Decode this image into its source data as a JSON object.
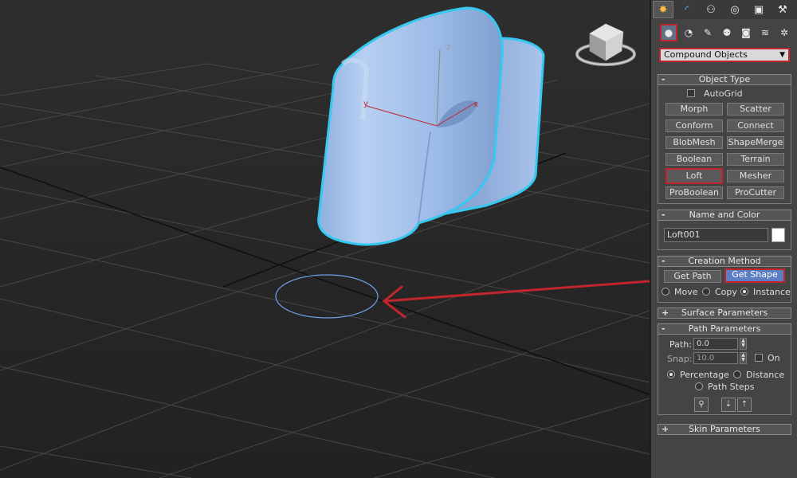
{
  "command_panel": {
    "tabs": [
      {
        "icon": "create-tab-icon",
        "glyph": "✸"
      },
      {
        "icon": "modify-tab-icon",
        "glyph": "◜"
      },
      {
        "icon": "hierarchy-tab-icon",
        "glyph": "⚇"
      },
      {
        "icon": "motion-tab-icon",
        "glyph": "◎"
      },
      {
        "icon": "display-tab-icon",
        "glyph": "▣"
      },
      {
        "icon": "utilities-tab-icon",
        "glyph": "⚒"
      }
    ],
    "categories": [
      {
        "icon": "geometry-icon",
        "glyph": "●"
      },
      {
        "icon": "shapes-icon",
        "glyph": "◔"
      },
      {
        "icon": "lights-icon",
        "glyph": "✎"
      },
      {
        "icon": "cameras-icon",
        "glyph": "⚉"
      },
      {
        "icon": "helpers-icon",
        "glyph": "◙"
      },
      {
        "icon": "space-warps-icon",
        "glyph": "≋"
      },
      {
        "icon": "systems-icon",
        "glyph": "✲"
      }
    ],
    "dropdown_value": "Compound Objects"
  },
  "object_type": {
    "title": "Object Type",
    "collapse_sign": "-",
    "autogrid_label": "AutoGrid",
    "buttons": [
      "Morph",
      "Scatter",
      "Conform",
      "Connect",
      "BlobMesh",
      "ShapeMerge",
      "Boolean",
      "Terrain",
      "Loft",
      "Mesher",
      "ProBoolean",
      "ProCutter"
    ]
  },
  "name_color": {
    "title": "Name and Color",
    "collapse_sign": "-",
    "name_value": "Loft001",
    "color": "#ffffff"
  },
  "creation_method": {
    "title": "Creation Method",
    "collapse_sign": "-",
    "get_path": "Get Path",
    "get_shape": "Get Shape",
    "options": [
      "Move",
      "Copy",
      "Instance"
    ],
    "selected_option": "Instance"
  },
  "surface_parameters": {
    "title": "Surface Parameters",
    "collapse_sign": "+"
  },
  "path_parameters": {
    "title": "Path Parameters",
    "collapse_sign": "-",
    "path_label": "Path:",
    "path_value": "0.0",
    "snap_label": "Snap:",
    "snap_value": "10.0",
    "on_label": "On",
    "percentage_label": "Percentage",
    "distance_label": "Distance",
    "path_steps_label": "Path Steps",
    "selected_mode": "Percentage"
  },
  "skin_parameters": {
    "title": "Skin Parameters",
    "collapse_sign": "+"
  },
  "viewport": {
    "axis_labels": {
      "x": "x",
      "y": "y",
      "z": "z"
    },
    "colors": {
      "object_fill": "#9fbde8",
      "object_outline": "#35c8f0",
      "grid": "#4a4a4a",
      "shape_circle": "#6fa0e8",
      "annotation_arrow": "#c0262b",
      "highlight": "#c0262b"
    }
  }
}
